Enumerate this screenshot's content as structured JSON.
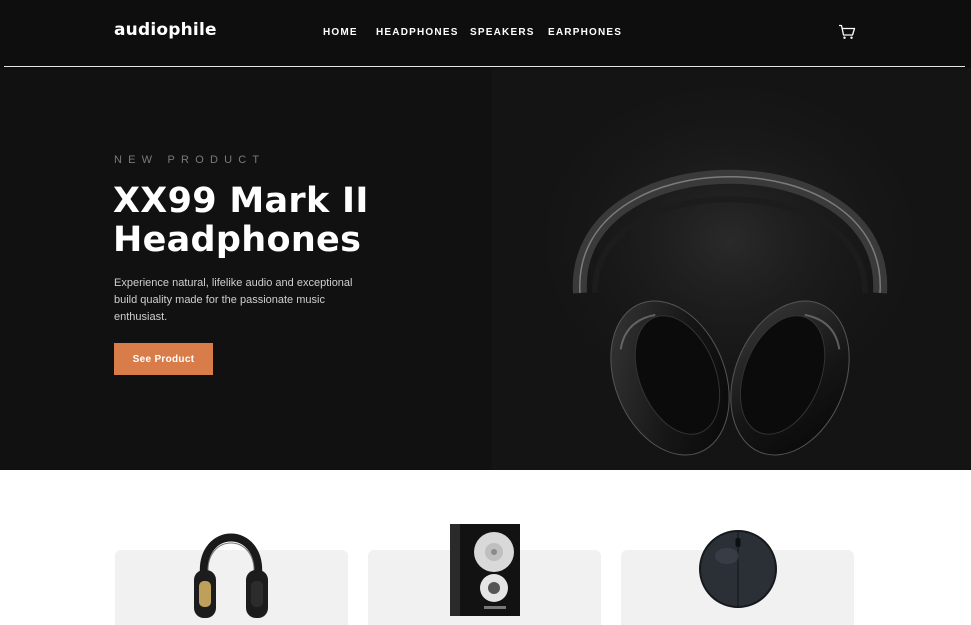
{
  "header": {
    "logo": "audiophile",
    "nav": [
      {
        "label": "HOME"
      },
      {
        "label": "HEADPHONES"
      },
      {
        "label": "SPEAKERS"
      },
      {
        "label": "EARPHONES"
      }
    ],
    "cart_icon": "cart-icon"
  },
  "hero": {
    "eyebrow": "NEW PRODUCT",
    "title": "XX99 Mark II Headphones",
    "description": "Experience natural, lifelike audio and exceptional build quality made for the passionate music enthusiast.",
    "cta_label": "See Product",
    "image": "headphones-image"
  },
  "categories": [
    {
      "image": "headphones-image"
    },
    {
      "image": "speaker-image"
    },
    {
      "image": "earphones-case-image"
    }
  ],
  "colors": {
    "accent": "#d87d4a",
    "dark": "#101010",
    "light_gray": "#f1f1f1"
  }
}
